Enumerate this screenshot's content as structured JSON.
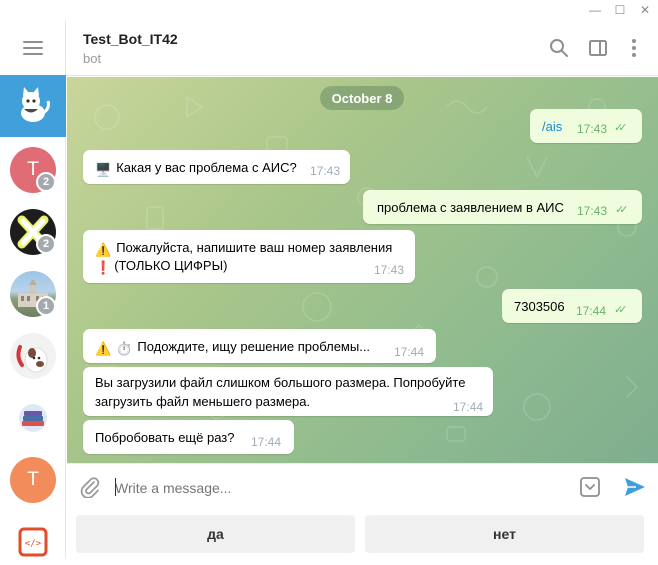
{
  "window": {
    "minimize": "—",
    "maximize": "☐",
    "close": "✕"
  },
  "sidebar": {
    "chats": [
      {
        "initial": "",
        "badge": "",
        "color": "#419fd9"
      },
      {
        "initial": "T",
        "badge": "2",
        "color": "#e57373"
      },
      {
        "initial": "",
        "badge": "2",
        "color": "#1d1d1d"
      },
      {
        "initial": "",
        "badge": "1",
        "color": "#7ba6cf"
      },
      {
        "initial": "",
        "badge": "",
        "color": "#f2f2f2"
      },
      {
        "initial": "",
        "badge": "",
        "color": "#ffffff"
      },
      {
        "initial": "T",
        "badge": "",
        "color": "#f08a5d"
      },
      {
        "initial": "",
        "badge": "",
        "color": "#e14d2a"
      }
    ]
  },
  "header": {
    "title": "Test_Bot_IT42",
    "status": "bot"
  },
  "chat": {
    "date": "October 8",
    "messages": [
      {
        "dir": "out",
        "text": "/ais",
        "time": "17:43"
      },
      {
        "dir": "in",
        "emoji": "🖥️",
        "text": "Какая у вас проблема с АИС?",
        "time": "17:43"
      },
      {
        "dir": "out",
        "text": "проблема с заявлением в АИС",
        "time": "17:43"
      },
      {
        "dir": "in",
        "emoji": "⚠️",
        "text": "Пожалуйста, напишите ваш номер заявления",
        "emoji2": "❗",
        "text2": "(ТОЛЬКО ЦИФРЫ)",
        "time": "17:43"
      },
      {
        "dir": "out",
        "text": "7303506",
        "time": "17:44"
      },
      {
        "dir": "in",
        "emoji": "⚠️",
        "emoji2": "⏱️",
        "text": "Подождите, ищу решение проблемы...",
        "time": "17:44"
      },
      {
        "dir": "in",
        "text": "Вы загрузили файл слишком большого размера. Попробуйте",
        "text2": "загрузить файл меньшего размера.",
        "time": "17:44"
      },
      {
        "dir": "in",
        "text": "Побробовать ещё раз?",
        "time": "17:44"
      }
    ]
  },
  "input": {
    "placeholder": "Write a message..."
  },
  "keyboard": {
    "yes": "да",
    "no": "нет"
  },
  "colors": {
    "accent": "#419fd9",
    "outgoing": "#effdde",
    "read_ticks": "#5fbc6a"
  }
}
